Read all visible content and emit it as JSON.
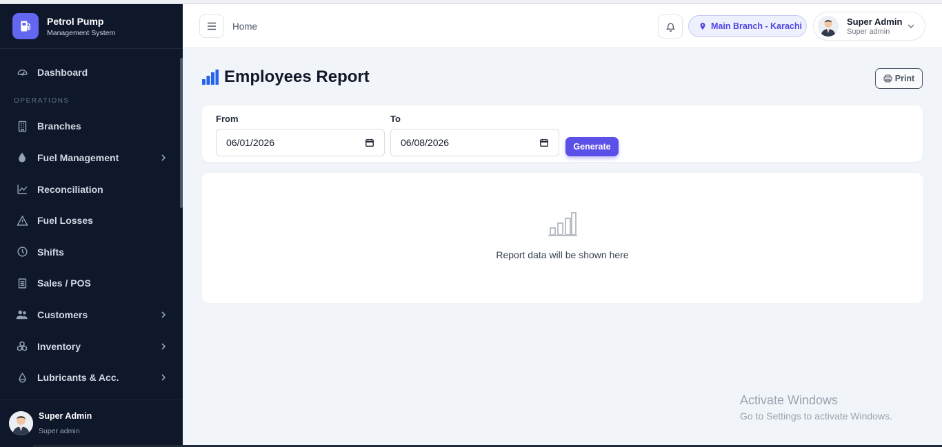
{
  "brand": {
    "title": "Petrol Pump",
    "subtitle": "Management System"
  },
  "sidebar": {
    "dashboard": "Dashboard",
    "section_operations": "OPERATIONS",
    "items": [
      {
        "label": "Branches",
        "icon": "building-icon",
        "has_children": false
      },
      {
        "label": "Fuel Management",
        "icon": "droplet-icon",
        "has_children": true
      },
      {
        "label": "Reconciliation",
        "icon": "chart-line-icon",
        "has_children": false
      },
      {
        "label": "Fuel Losses",
        "icon": "warning-icon",
        "has_children": false
      },
      {
        "label": "Shifts",
        "icon": "clock-icon",
        "has_children": false
      },
      {
        "label": "Sales / POS",
        "icon": "receipt-icon",
        "has_children": false
      },
      {
        "label": "Customers",
        "icon": "users-icon",
        "has_children": true
      },
      {
        "label": "Inventory",
        "icon": "boxes-icon",
        "has_children": true
      },
      {
        "label": "Lubricants & Acc.",
        "icon": "oil-drop-icon",
        "has_children": true
      }
    ],
    "user": {
      "name": "Super Admin",
      "role": "Super admin"
    }
  },
  "header": {
    "breadcrumb": "Home",
    "branch": "Main Branch - Karachi",
    "user": {
      "name": "Super Admin",
      "role": "Super admin"
    }
  },
  "page": {
    "title": "Employees Report",
    "print_label": "Print",
    "filters": {
      "from_label": "From",
      "from_value": "06/01/2026",
      "to_label": "To",
      "to_value": "06/08/2026",
      "generate_label": "Generate"
    },
    "empty_text": "Report data will be shown here"
  },
  "watermark": {
    "title": "Activate Windows",
    "subtitle": "Go to Settings to activate Windows."
  },
  "colors": {
    "sidebar_bg": "#0f172a",
    "accent": "#5b50e8",
    "branch_text": "#4f46e5",
    "page_bg": "#f1f4f9"
  }
}
